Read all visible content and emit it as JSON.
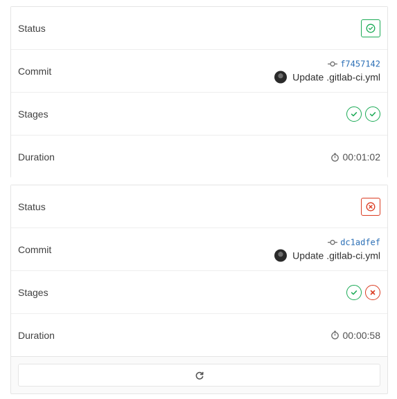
{
  "pipelines": [
    {
      "status_label": "Status",
      "status": "success",
      "commit_label": "Commit",
      "commit_sha": "f7457142",
      "commit_title": "Update .gitlab-ci.yml",
      "stages_label": "Stages",
      "stages": [
        "success",
        "success"
      ],
      "duration_label": "Duration",
      "duration": "00:01:02"
    },
    {
      "status_label": "Status",
      "status": "failed",
      "commit_label": "Commit",
      "commit_sha": "dc1adfef",
      "commit_title": "Update .gitlab-ci.yml",
      "stages_label": "Stages",
      "stages": [
        "success",
        "failed"
      ],
      "duration_label": "Duration",
      "duration": "00:00:58"
    }
  ],
  "icons": {
    "status_success": "check-circle-icon",
    "status_failed": "x-circle-icon",
    "commit": "commit-icon",
    "duration": "stopwatch-icon",
    "refresh": "refresh-icon"
  },
  "colors": {
    "success": "#1aaa55",
    "failed": "#db3b21",
    "sha": "#2b6fb6"
  }
}
